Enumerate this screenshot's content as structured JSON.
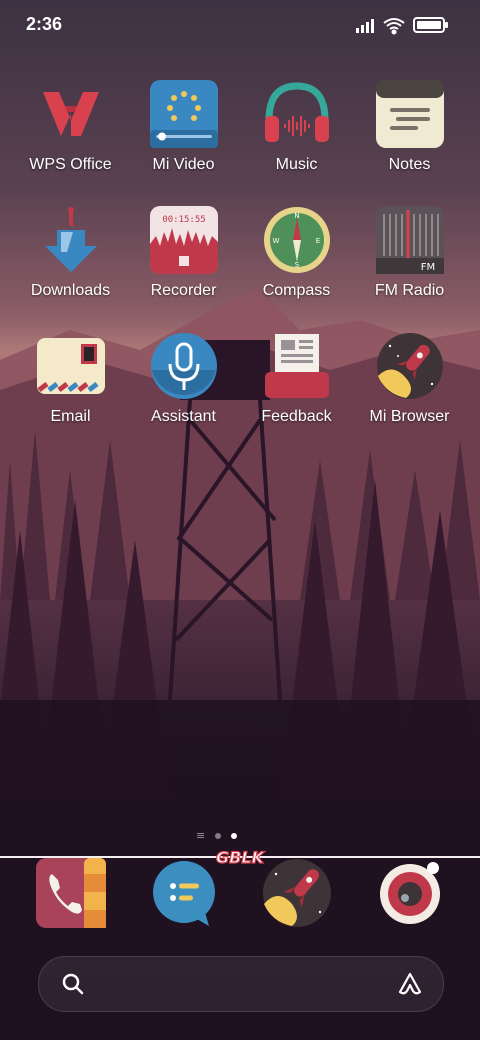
{
  "status": {
    "time": "2:36"
  },
  "apps": [
    {
      "label": "WPS Office",
      "icon": "wps-office-icon"
    },
    {
      "label": "Mi Video",
      "icon": "mi-video-icon"
    },
    {
      "label": "Music",
      "icon": "music-icon"
    },
    {
      "label": "Notes",
      "icon": "notes-icon"
    },
    {
      "label": "Downloads",
      "icon": "downloads-icon"
    },
    {
      "label": "Recorder",
      "icon": "recorder-icon",
      "timer": "00:15:55"
    },
    {
      "label": "Compass",
      "icon": "compass-icon",
      "letters": [
        "N",
        "E",
        "S",
        "W"
      ]
    },
    {
      "label": "FM Radio",
      "icon": "fm-radio-icon",
      "badge": "FM"
    },
    {
      "label": "Email",
      "icon": "email-icon"
    },
    {
      "label": "Assistant",
      "icon": "assistant-icon"
    },
    {
      "label": "Feedback",
      "icon": "feedback-icon"
    },
    {
      "label": "Mi Browser",
      "icon": "mi-browser-icon"
    }
  ],
  "dock": [
    {
      "icon": "phone-icon"
    },
    {
      "icon": "messaging-icon"
    },
    {
      "icon": "browser-icon"
    },
    {
      "icon": "camera-icon"
    }
  ],
  "page_indicator": {
    "pages": 2,
    "active": 2
  },
  "watermark": "GBLK",
  "colors": {
    "accent": "#c0394b",
    "compass": "#e6d48a",
    "dock_message": "#3a8ec0"
  }
}
